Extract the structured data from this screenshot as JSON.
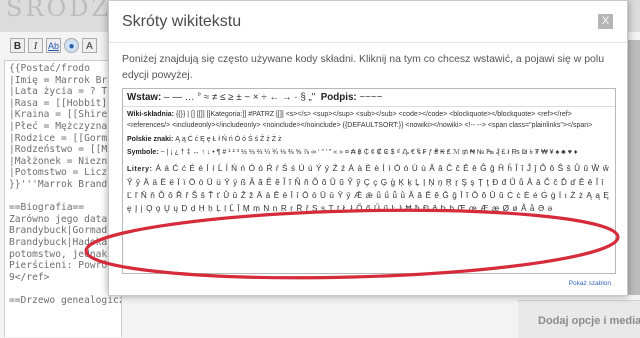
{
  "background": {
    "logo": "ŚRODZIE",
    "toolbar": [
      {
        "label": "B",
        "cls": "b"
      },
      {
        "label": "I",
        "cls": "i"
      },
      {
        "label": "Ab",
        "cls": "ab"
      },
      {
        "label": "●",
        "cls": "globe"
      },
      {
        "label": "A",
        "cls": ""
      }
    ],
    "editor_lines": [
      "{{Postać/frodo",
      "|Imię = Marrok Brand",
      "|Lata życia = ? TE",
      "|Rasa = [[Hobbit]]",
      "|Kraina = [[Shire]]",
      "|Płeć = Mężczyzna",
      "|Rodzice = [[Gormad",
      "|Rodzeństwo = [[Mad",
      "|Małżonek = Nieznan",
      "|Potomstwo = Liczni",
      "}}'''Marrok Brandyb",
      "",
      "==Biografia==",
      "Zarówno jego data",
      "Brandybuck|Gormad",
      "Brandybuck|Hadoka]",
      "potomstwo, jednak j",
      "Pierścieni: Powrót",
      "9</ref>",
      "",
      "==Drzewo genealogiczne=="
    ],
    "right_panel_text": "Dodaj opcje i media"
  },
  "modal": {
    "title": "Skróty wikitekstu",
    "close_label": "X",
    "description": "Poniżej znajdują się często używane kody składni. Kliknij na tym co chcesz wstawić, a pojawi się w polu edycji powyżej.",
    "insert_label": "Wstaw:",
    "insert_symbols": "– — …  ° ≈ ≠ ≤ ≥ ± − × ÷ ← → · § „\"",
    "signature_label": "Podpis:",
    "signature_value": "~~~~",
    "wiki_label": "Wiki-składnia:",
    "wiki_items": "{{}}  |  []  [[]]  [[Kategoria:]]  #PATRZ [[]]  <s></s>  <sup></sup>  <sub></sub>  <code></code>  <blockquote></blockquote>  <ref></ref>  <references/>  <includeonly></includeonly>  <noinclude></noinclude>  {{DEFAULTSORT:}}  <nowiki></nowiki>  <!-- -->  <span class=\"plainlinks\"></span>",
    "polish_label": "Polskie znaki:",
    "polish_chars": "Ą ą Ć ć Ę ę Ł ł Ń ń Ó ó Ś ś Ź ź Ż ż",
    "symbols_label": "Symbole:",
    "symbols_chars": "~ | ¡ ¿ † ‡ ↔ ↑ ↓ • ¶ # ¹ ² ³ ½ ⅓ ⅔ ¼ ¾ ⅛ ⅜ ⅝ ⅞ ∞ ‘ “ ’ ” « » ¤ ₳ ฿ ₵ ¢ ₡ ₢ $ ₫ ₯ € ₠ ₣ ƒ ₴ ₭ ₤ ℳ ₥ ₦ № ₧ ₰ £ ៛ ₨ ₪ ৳ ₮ ₩ ¥ ♠ ♣ ♥ ♦",
    "letters_label": "Litery:",
    "letters_chars": "Á á Ć ć É é Í í Ĺ ĺ Ń ń Ó ó Ŕ ŕ Ś ś Ú ú Ý ý Ź ź  À à È è Ì ì Ò ò Ù ù  Â â Ĉ ĉ Ê ê Ĝ ĝ Ĥ ĥ Î î Ĵ ĵ Ô ô Ŝ ŝ Û û Ŵ ŵ Ŷ ŷ  Ä ä Ë ë Ï ï Ö ö Ü ü Ÿ ÿ  ß  Ã ã Ẽ ẽ Ĩ ĩ Ñ ñ Õ õ Ũ ũ Ỹ ỹ  Ç ç Ģ ģ Ķ ķ Ļ ļ Ņ ņ Ŗ ŗ Ş ş Ţ ţ  Đ đ  Ů ů  Ǎ ǎ Č č Ď ď Ě ě Ǐ ǐ Ľ ľ Ň ň Ǒ ǒ Ř ř Š š Ť ť Ǔ ǔ Ž ž  Ā ā Ē ē Ī ī Ō ō Ū ū Ȳ ȳ Ǣ ǣ  ǖ ǘ ǚ ǜ  Ă ă Ĕ ĕ Ğ ğ Ĭ ĭ Ŏ ŏ Ŭ ŭ  Ċ ċ Ė ė Ġ ġ İ ı Ż ż  Ą ą Ę ę Į į Ǫ ǫ Ų ų  Ḍ ḍ Ḥ ḥ Ḷ ḷ Ḹ ḹ Ṃ ṃ Ṇ ṇ Ṛ ṛ Ṝ ṝ Ṣ ṣ Ṭ ṭ  Ł ł  Ő ő Ű ű  Ŀ ŀ  Ħ ħ  Ð ð Þ þ  Œ œ  Æ æ Ø ø Å å  Ə ə",
    "show_template": "Pokaż szablon"
  },
  "annotation": {
    "color": "#d62b3b"
  }
}
